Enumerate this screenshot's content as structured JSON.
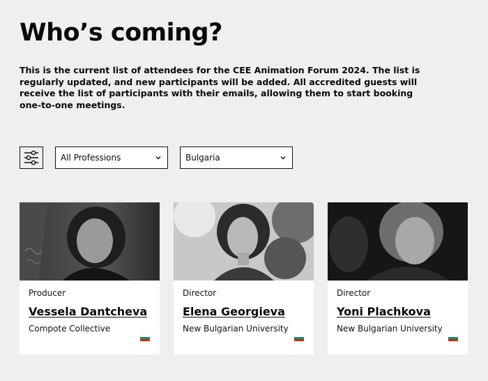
{
  "header": {
    "title": "Who’s coming?",
    "intro": "This is the current list of attendees for the CEE Animation Forum 2024. The list is regularly updated, and new participants will be added. All accredited guests will receive the list of participants with their emails, allowing them to start booking one-to-one meetings."
  },
  "filters": {
    "filter_icon": "sliders-icon",
    "profession": {
      "selected": "All Professions"
    },
    "country": {
      "selected": "Bulgaria"
    }
  },
  "attendees": [
    {
      "role": "Producer",
      "name": "Vessela Dantcheva",
      "organization": "Compote Collective",
      "flag": "bulgaria-flag-icon"
    },
    {
      "role": "Director",
      "name": "Elena Georgieva",
      "organization": "New Bulgarian University",
      "flag": "bulgaria-flag-icon"
    },
    {
      "role": "Director",
      "name": "Yoni Plachkova",
      "organization": "New Bulgarian University",
      "flag": "bulgaria-flag-icon"
    }
  ],
  "colors": {
    "background": "#efeff0",
    "text": "#0a0a0a",
    "card": "#ffffff",
    "flag_white": "#ffffff",
    "flag_green": "#00966e",
    "flag_red": "#d62612"
  }
}
